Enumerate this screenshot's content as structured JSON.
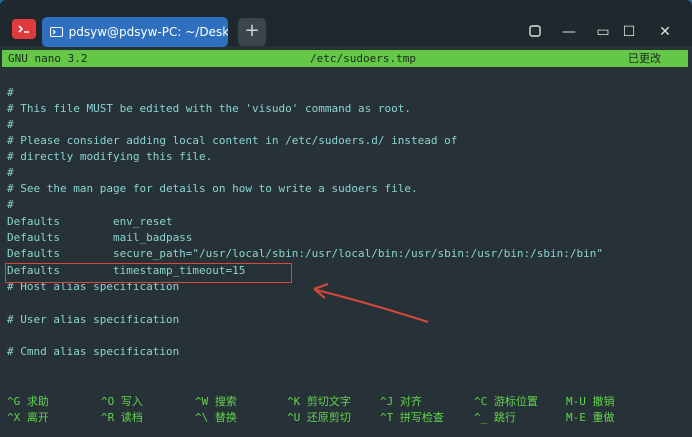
{
  "window": {
    "tab_title": "pdsyw@pdsyw-PC: ~/Desktop",
    "new_tab": "+",
    "controls": [
      "—",
      "▭",
      "☐",
      "✕"
    ]
  },
  "nano": {
    "version": "GNU nano 3.2",
    "filename": "/etc/sudoers.tmp",
    "modified": "已更改"
  },
  "lines": [
    "#",
    "# This file MUST be edited with the 'visudo' command as root.",
    "#",
    "# Please consider adding local content in /etc/sudoers.d/ instead of",
    "# directly modifying this file.",
    "#",
    "# See the man page for details on how to write a sudoers file.",
    "#",
    "Defaults        env_reset",
    "Defaults        mail_badpass",
    "Defaults        secure_path=\"/usr/local/sbin:/usr/local/bin:/usr/sbin:/usr/bin:/sbin:/bin\"",
    "Defaults        timestamp_timeout=15",
    "# Host alias specification",
    "",
    "# User alias specification",
    "",
    "# Cmnd alias specification"
  ],
  "shortcuts": [
    {
      "key": "^G",
      "label": "求助"
    },
    {
      "key": "^O",
      "label": "写入"
    },
    {
      "key": "^W",
      "label": "搜索"
    },
    {
      "key": "^K",
      "label": "剪切文字"
    },
    {
      "key": "^J",
      "label": "对齐"
    },
    {
      "key": "^C",
      "label": "游标位置"
    },
    {
      "key": "M-U",
      "label": "撤销"
    },
    {
      "key": "^X",
      "label": "离开"
    },
    {
      "key": "^R",
      "label": "读档"
    },
    {
      "key": "^\\",
      "label": "替换"
    },
    {
      "key": "^U",
      "label": "还原剪切"
    },
    {
      "key": "^T",
      "label": "拼写检查"
    },
    {
      "key": "^_",
      "label": "跳行"
    },
    {
      "key": "M-E",
      "label": "重做"
    }
  ],
  "colors": {
    "terminal_bg": "#263238",
    "text": "#8bd4d0",
    "status_bg": "#64c846",
    "highlight": "#d9483c"
  }
}
